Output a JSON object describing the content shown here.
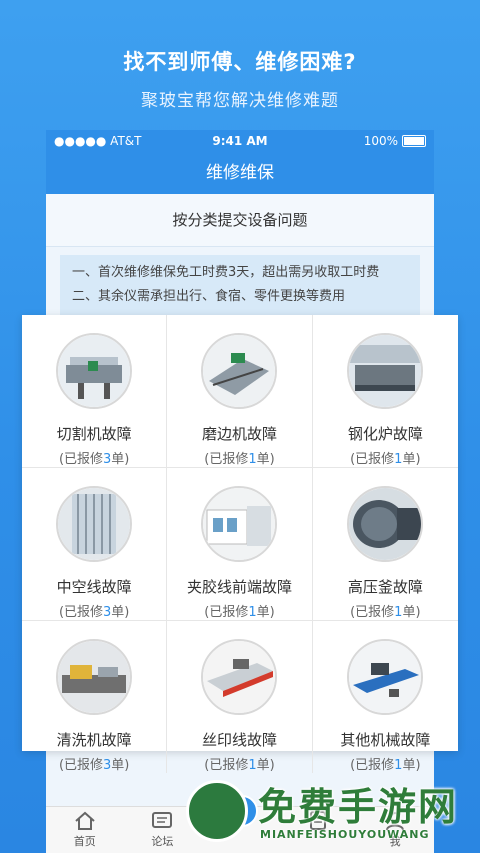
{
  "promo": {
    "title": "找不到师傅、维修困难?",
    "subtitle": "聚玻宝帮您解决维修难题"
  },
  "status_bar": {
    "carrier": "●●●●● AT&T",
    "time": "9:41 AM",
    "battery": "100%"
  },
  "navbar": {
    "title": "维修维保"
  },
  "category_bar": {
    "label": "按分类提交设备问题"
  },
  "notice": {
    "line1": "一、首次维修维保免工时费3天，超出需另收取工时费",
    "line2": "二、其余仪需承担出行、食宿、零件更换等费用"
  },
  "grid": [
    {
      "label": "切割机故障",
      "count_prefix": "(已报修",
      "count": "3",
      "count_suffix": "单)"
    },
    {
      "label": "磨边机故障",
      "count_prefix": "(已报修",
      "count": "1",
      "count_suffix": "单)"
    },
    {
      "label": "钢化炉故障",
      "count_prefix": "(已报修",
      "count": "1",
      "count_suffix": "单)"
    },
    {
      "label": "中空线故障",
      "count_prefix": "(已报修",
      "count": "3",
      "count_suffix": "单)"
    },
    {
      "label": "夹胶线前端故障",
      "count_prefix": "(已报修",
      "count": "1",
      "count_suffix": "单)"
    },
    {
      "label": "高压釜故障",
      "count_prefix": "(已报修",
      "count": "1",
      "count_suffix": "单)"
    },
    {
      "label": "清洗机故障",
      "count_prefix": "(已报修",
      "count": "3",
      "count_suffix": "单)"
    },
    {
      "label": "丝印线故障",
      "count_prefix": "(已报修",
      "count": "1",
      "count_suffix": "单)"
    },
    {
      "label": "其他机械故障",
      "count_prefix": "(已报修",
      "count": "1",
      "count_suffix": "单)"
    }
  ],
  "tabbar": [
    {
      "label": "首页",
      "icon": "home-icon"
    },
    {
      "label": "论坛",
      "icon": "forum-icon"
    },
    {
      "label": "",
      "icon": "repair-icon"
    },
    {
      "label": "",
      "icon": "document-icon"
    },
    {
      "label": "我",
      "icon": "user-icon"
    }
  ],
  "watermark": {
    "text": "免费手游网",
    "subtext": "MIANFEISHOUYOUWANG"
  },
  "colors": {
    "brand_blue": "#2f8fe8",
    "notice_bg": "#d7e9f8",
    "watermark_green": "#2f7d3a"
  }
}
